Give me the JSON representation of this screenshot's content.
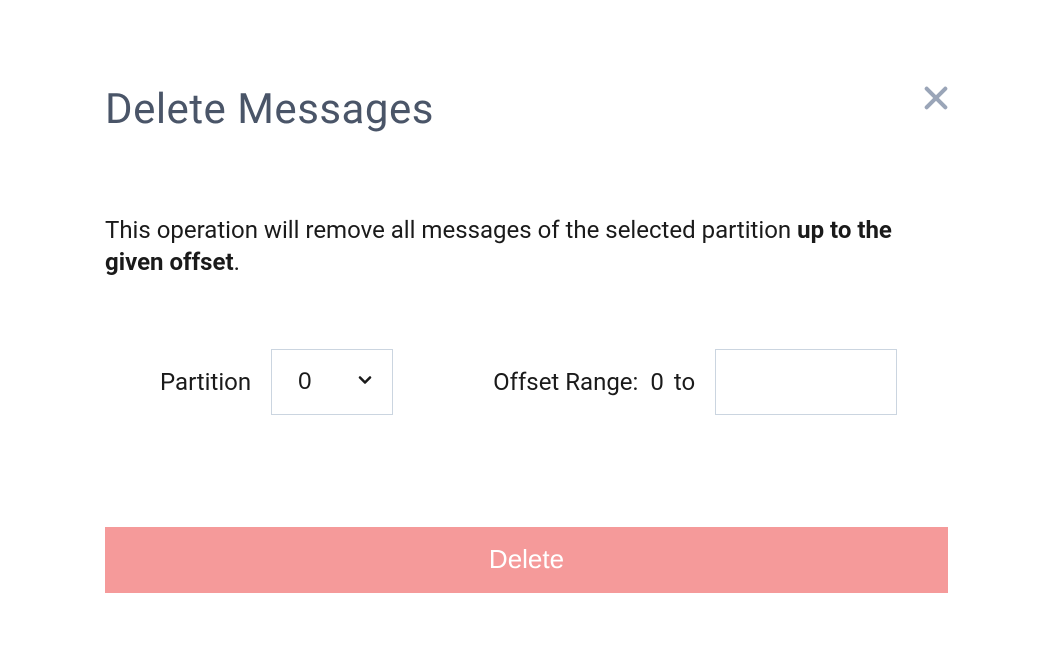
{
  "modal": {
    "title": "Delete Messages",
    "description_prefix": "This operation will remove all messages of the selected partition ",
    "description_bold": "up to the given offset",
    "description_suffix": ".",
    "partition_label": "Partition",
    "partition_value": "0",
    "offset_label": "Offset Range:",
    "offset_start": "0",
    "offset_to": "to",
    "offset_end_value": "",
    "delete_button": "Delete"
  }
}
